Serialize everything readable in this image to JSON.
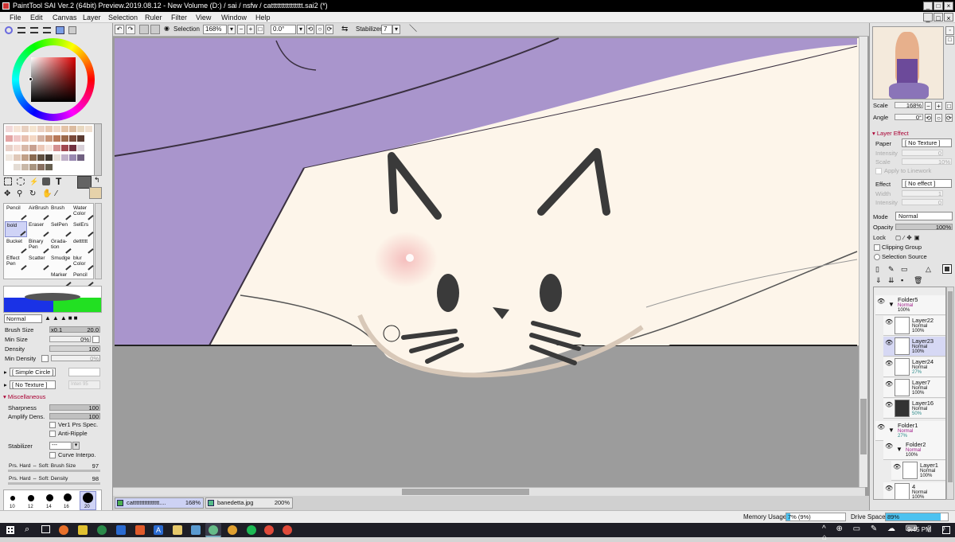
{
  "title": "PaintTool SAI Ver.2 (64bit) Preview.2019.08.12 - New Volume (D:) / sai / nsfw / catttttttttttttttt.sai2 (*)",
  "menu": [
    "File",
    "Edit",
    "Canvas",
    "Layer",
    "Selection",
    "Ruler",
    "Filter",
    "View",
    "Window",
    "Help"
  ],
  "toolbar": {
    "selection_label": "Selection",
    "zoom": "168%",
    "angle": "0.0°",
    "stabilizer_label": "Stabilizer",
    "stabilizer_value": "7"
  },
  "left": {
    "tools": [
      {
        "label": "Pencil"
      },
      {
        "label": "AirBrush"
      },
      {
        "label": "Brush"
      },
      {
        "label": "Water Color"
      },
      {
        "label": "bold"
      },
      {
        "label": "Eraser"
      },
      {
        "label": "SelPen"
      },
      {
        "label": "SelErs"
      },
      {
        "label": "Bucket"
      },
      {
        "label": "Binary Pen"
      },
      {
        "label": "Grada- tion"
      },
      {
        "label": "detttttt"
      },
      {
        "label": "Effect Pen"
      },
      {
        "label": "Scatter"
      },
      {
        "label": "Smudge"
      },
      {
        "label": "blur Color"
      },
      {
        "label": ""
      },
      {
        "label": ""
      },
      {
        "label": "Marker"
      },
      {
        "label": "Pencil"
      }
    ],
    "blend_mode": "Normal",
    "brush_size": {
      "label": "Brush Size",
      "mult": "x0.1",
      "value": "20.0"
    },
    "min_size": {
      "label": "Min Size",
      "value": "0%"
    },
    "density": {
      "label": "Density",
      "value": "100"
    },
    "min_density": {
      "label": "Min Density",
      "value": "0%"
    },
    "shape": "[ Simple Circle ]",
    "texture": "[ No Texture ]",
    "texture_inten": "Inten 95",
    "misc_header": "Miscellaneous",
    "sharpness": {
      "label": "Sharpness",
      "value": "100"
    },
    "amplify": {
      "label": "Amplify Dens.",
      "value": "100"
    },
    "ver1": "Ver1 Prs Spec.",
    "antiripple": "Anti-Ripple",
    "stabilizer": {
      "label": "Stabilizer",
      "value": "---"
    },
    "curve": "Curve Interpo.",
    "prs_size": {
      "label": "Prs. Hard ⇔ Soft: Brush Size",
      "value": "97"
    },
    "prs_dens": {
      "label": "Prs. Hard ⇔ Soft: Density",
      "value": "98"
    },
    "sizes": [
      "10",
      "12",
      "14",
      "16",
      "20"
    ]
  },
  "tabs": [
    {
      "name": "catttttttttttttttt....",
      "zoom": "168%"
    },
    {
      "name": "banedetta.jpg",
      "zoom": "200%"
    }
  ],
  "right": {
    "scale": {
      "label": "Scale",
      "value": "168%"
    },
    "angle": {
      "label": "Angle",
      "value": "0°"
    },
    "layer_effect": "Layer Effect",
    "paper": {
      "label": "Paper",
      "value": "[ No Texture ]"
    },
    "intensity": {
      "label": "Intensity",
      "value": "0"
    },
    "scale2": {
      "label": "Scale",
      "value": "10%"
    },
    "apply_linework": "Apply to Linework",
    "effect": {
      "label": "Effect",
      "value": "[ No effect ]"
    },
    "width": {
      "label": "Width",
      "value": "1"
    },
    "intensity2": {
      "label": "Intensity",
      "value": "0"
    },
    "mode": {
      "label": "Mode",
      "value": "Normal"
    },
    "opacity": {
      "label": "Opacity",
      "value": "100%"
    },
    "lock": "Lock",
    "clipping": "Clipping Group",
    "selection_source": "Selection Source",
    "layers": [
      {
        "name": "Folder5",
        "mode": "Normal",
        "opacity": "100%",
        "folder": true
      },
      {
        "name": "Layer22",
        "mode": "Normal",
        "opacity": "100%"
      },
      {
        "name": "Layer23",
        "mode": "Normal",
        "opacity": "100%"
      },
      {
        "name": "Layer24",
        "mode": "Normal",
        "opacity": "27%"
      },
      {
        "name": "Layer7",
        "mode": "Normal",
        "opacity": "100%"
      },
      {
        "name": "Layer16",
        "mode": "Normal",
        "opacity": "50%"
      },
      {
        "name": "Folder1",
        "mode": "Normal",
        "opacity": "27%",
        "folder": true
      },
      {
        "name": "Folder2",
        "mode": "Normal",
        "opacity": "100%",
        "folder": true
      },
      {
        "name": "Layer1",
        "mode": "Normal",
        "opacity": "100%"
      },
      {
        "name": "4",
        "mode": "Normal",
        "opacity": "100%"
      }
    ]
  },
  "status": {
    "memory_label": "Memory Usage",
    "memory_value": "7% (9%)",
    "drive_label": "Drive Space",
    "drive_value": "89%"
  },
  "taskbar": {
    "time": "9:45 PM"
  }
}
